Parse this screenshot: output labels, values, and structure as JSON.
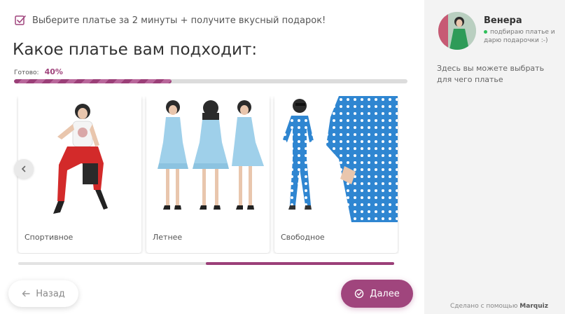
{
  "header": {
    "promo_text": "Выберите платье за 2 минуты + получите вкусный подарок!",
    "question": "Какое платье вам подходит:"
  },
  "progress": {
    "label": "Готово:",
    "value_text": "40%",
    "value": 0.4
  },
  "options": [
    {
      "label": "Спортивное"
    },
    {
      "label": "Летнее"
    },
    {
      "label": "Свободное"
    }
  ],
  "navigation": {
    "back_label": "Назад",
    "next_label": "Далее"
  },
  "sidebar": {
    "consultant_name": "Венера",
    "consultant_status": "подбираю платье и дарю подарочки :-)",
    "description": "Здесь вы можете выбрать для чего платье",
    "made_with_prefix": "Сделано с помощью",
    "made_with_brand": "Marquiz"
  },
  "colors": {
    "accent": "#a0457d",
    "sidebar_bg": "#f3f3f3",
    "dress_red": "#d32a2a",
    "dress_lightblue": "#9fd0ea",
    "dress_blue": "#2f86d1"
  }
}
